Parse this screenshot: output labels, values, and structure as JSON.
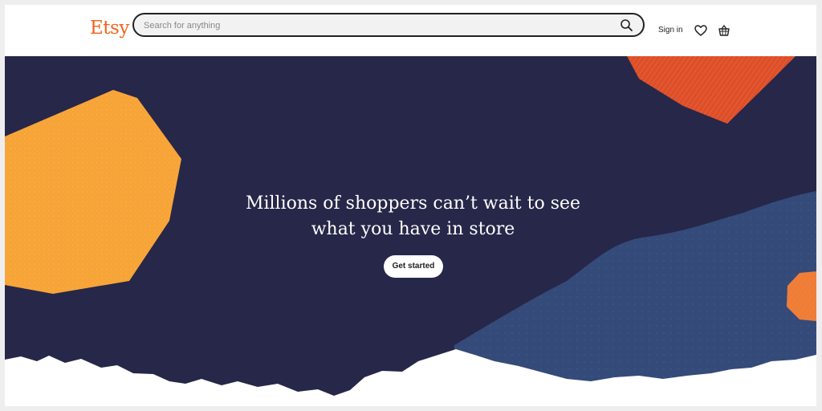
{
  "header": {
    "logo": "Etsy",
    "search_placeholder": "Search for anything",
    "signin_label": "Sign in",
    "icons": {
      "search": "search-icon",
      "favorites": "heart-icon",
      "cart": "basket-icon"
    }
  },
  "hero": {
    "headline_line1": "Millions of shoppers can’t wait to see",
    "headline_line2": "what you have in store",
    "cta_label": "Get started"
  },
  "colors": {
    "brand": "#f1641e",
    "hero_background": "#262749",
    "hero_blue": "#344a79",
    "orange_shape": "#f7a437",
    "red_shape": "#dd4e29"
  }
}
